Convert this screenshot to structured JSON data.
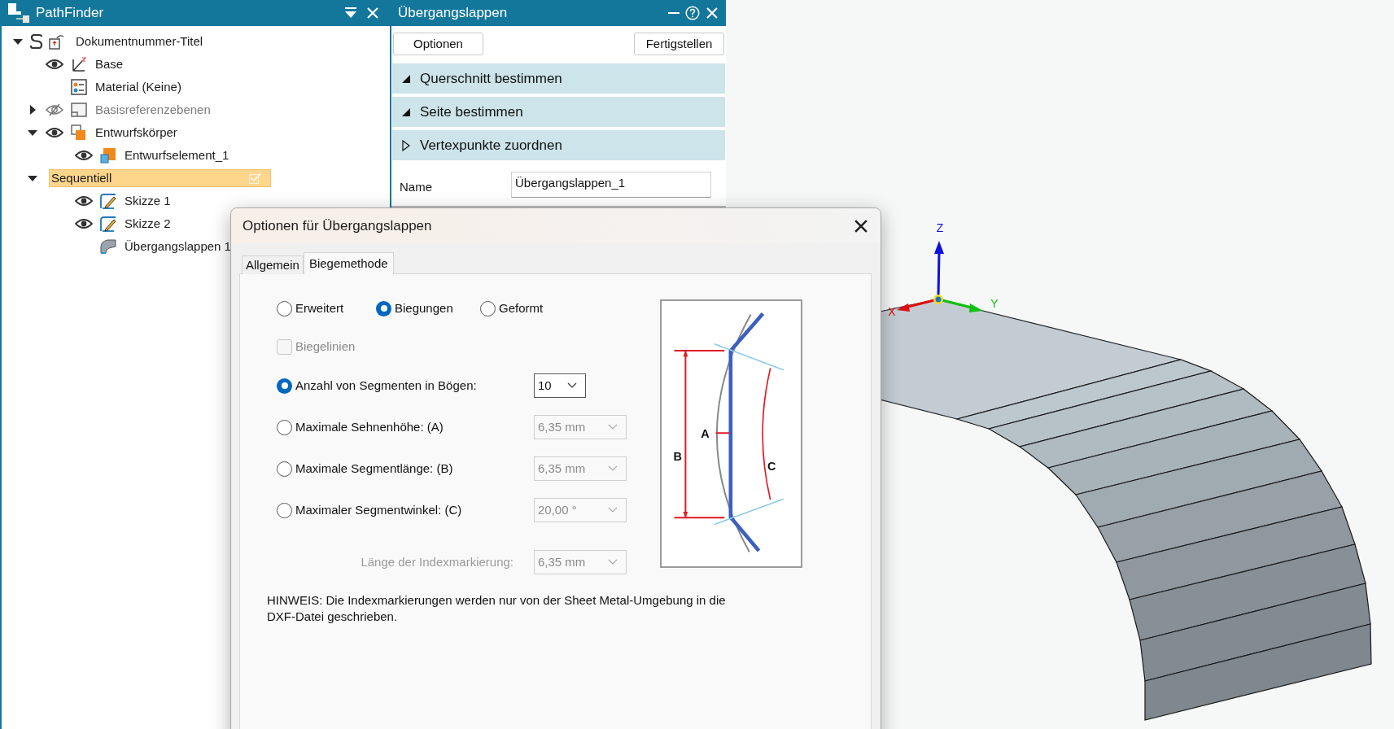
{
  "pathfinder": {
    "title": "PathFinder",
    "tree": [
      {
        "label": "Dokumentnummer-Titel",
        "kind": "document",
        "expanded": true,
        "selected": false,
        "children": [
          {
            "label": "Base",
            "kind": "axes",
            "visible": true,
            "selected": false
          },
          {
            "label": "Material (Keine)",
            "kind": "material",
            "selected": false
          },
          {
            "label": "Basisreferenzebenen",
            "kind": "planes",
            "expanded": false,
            "visible": false,
            "disabled": true,
            "selected": false
          },
          {
            "label": "Entwurfskörper",
            "kind": "body",
            "expanded": true,
            "visible": true,
            "selected": false,
            "children": [
              {
                "label": "Entwurfselement_1",
                "kind": "element",
                "visible": true,
                "selected": false
              }
            ]
          },
          {
            "label": "Sequentiell",
            "kind": "group",
            "expanded": true,
            "selected": true,
            "children": [
              {
                "label": "Skizze 1",
                "kind": "sketch",
                "visible": true,
                "selected": false
              },
              {
                "label": "Skizze 2",
                "kind": "sketch",
                "visible": true,
                "selected": false
              },
              {
                "label": "Übergangslappen 1",
                "kind": "feature",
                "selected": false
              }
            ]
          }
        ]
      }
    ]
  },
  "property_panel": {
    "title": "Übergangslappen",
    "buttons": [
      "Optionen",
      "Fertigstellen"
    ],
    "sections": [
      {
        "label": "Querschnitt bestimmen",
        "expanded": true
      },
      {
        "label": "Seite bestimmen",
        "expanded": true
      },
      {
        "label": "Vertexpunkte zuordnen",
        "expanded": false
      }
    ],
    "name_field": {
      "label": "Name",
      "value": "Übergangslappen_1"
    }
  },
  "dialog": {
    "title": "Optionen für Übergangslappen",
    "tabs": [
      {
        "label": "Allgemein",
        "selected": false
      },
      {
        "label": "Biegemethode",
        "selected": true
      }
    ],
    "method_options": [
      {
        "label": "Erweitert",
        "selected": false
      },
      {
        "label": "Biegungen",
        "selected": true
      },
      {
        "label": "Geformt",
        "selected": false
      }
    ],
    "bend_lines": {
      "label": "Biegelinien",
      "checked": false,
      "disabled": true
    },
    "segment_options": [
      {
        "label": "Anzahl von Segmenten in Bögen:",
        "selected": true,
        "value": "10",
        "disabled": false
      },
      {
        "label": "Maximale Sehnenhöhe: (A)",
        "selected": false,
        "value": "6,35 mm",
        "disabled": true
      },
      {
        "label": "Maximale Segmentlänge: (B)",
        "selected": false,
        "value": "6,35 mm",
        "disabled": true
      },
      {
        "label": "Maximaler Segmentwinkel: (C)",
        "selected": false,
        "value": "20,00 °",
        "disabled": true
      }
    ],
    "index_mark": {
      "label": "Länge der Indexmarkierung:",
      "value": "6,35 mm",
      "disabled": true
    },
    "note": "HINWEIS: Die Indexmarkierungen werden nur von der Sheet Metal-Umgebung in die DXF-Datei geschrieben.",
    "diagram_labels": [
      "A",
      "B",
      "C"
    ]
  },
  "viewport": {
    "axes": [
      {
        "label": "Z",
        "color": "#1010e0"
      },
      {
        "label": "X",
        "color": "#e01010"
      },
      {
        "label": "Y",
        "color": "#10c010"
      }
    ]
  }
}
